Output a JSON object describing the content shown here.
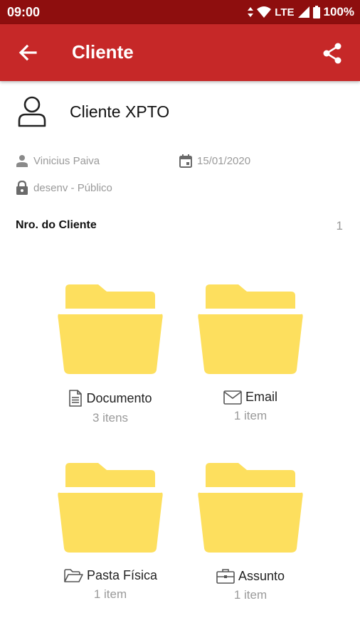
{
  "status_bar": {
    "time": "09:00",
    "network": "LTE",
    "battery": "100%"
  },
  "app_bar": {
    "title": "Cliente",
    "background_color": "#c62828",
    "status_color": "#8e0e0e"
  },
  "client": {
    "name": "Cliente XPTO",
    "user": "Vinicius Paiva",
    "date": "15/01/2020",
    "access": "desenv - Público"
  },
  "field": {
    "label": "Nro. do Cliente",
    "value": "1"
  },
  "folder_color": "#fddf5e",
  "folders": [
    {
      "icon": "document-icon",
      "title": "Documento",
      "count": "3 itens"
    },
    {
      "icon": "email-icon",
      "title": "Email",
      "count": "1 item"
    },
    {
      "icon": "folder-open-icon",
      "title": "Pasta Física",
      "count": "1 item"
    },
    {
      "icon": "briefcase-icon",
      "title": "Assunto",
      "count": "1 item"
    }
  ]
}
